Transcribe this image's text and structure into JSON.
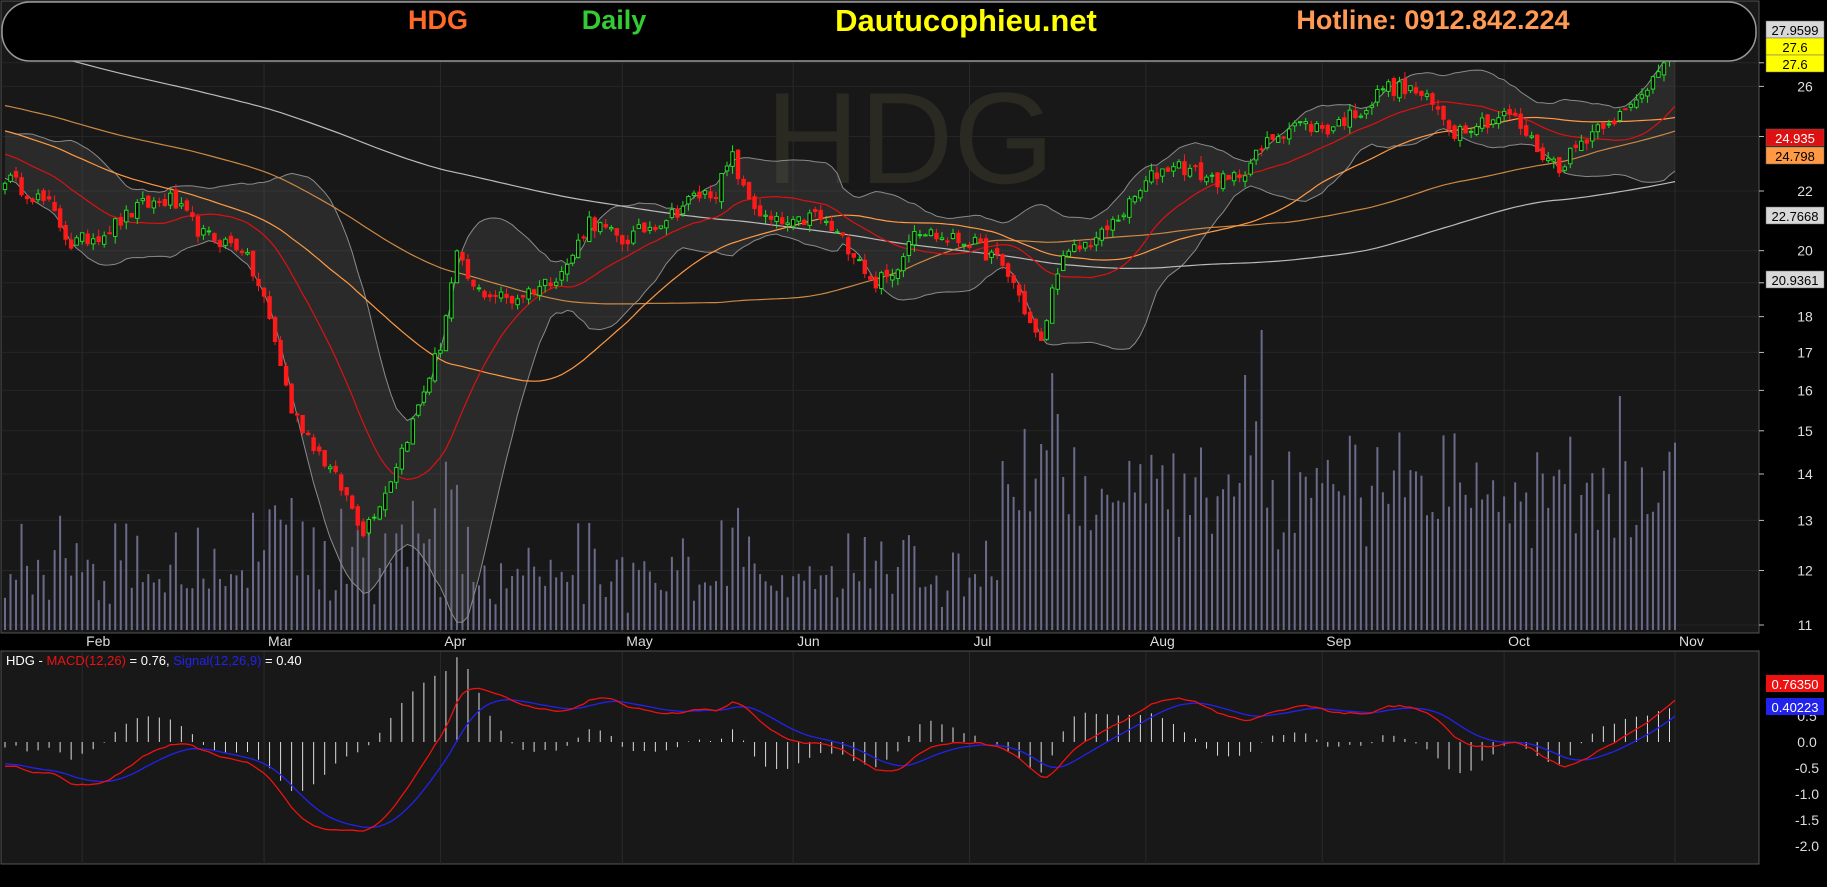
{
  "header": {
    "symbol": "HDG",
    "period": "Daily",
    "site": "Dautucophieu.net",
    "hotline": "Hotline: 0912.842.224",
    "symbol_color": "#ff6a2a",
    "period_color": "#33cc33",
    "site_color": "#ffff00",
    "hotline_color": "#ff9a55"
  },
  "watermark": "HDG",
  "chart_data": [
    {
      "type": "candlestick",
      "panel": "price",
      "x_labels": [
        "Feb",
        "Mar",
        "Apr",
        "May",
        "Jun",
        "Jul",
        "Aug",
        "Sep",
        "Oct",
        "Nov"
      ],
      "y_ticks": [
        11,
        12,
        13,
        14,
        15,
        16,
        17,
        18,
        19,
        20,
        22,
        24,
        26,
        27
      ],
      "ylim": [
        11,
        28
      ],
      "y_scale": "log",
      "grid": true,
      "price_tags": [
        {
          "label": "27.9599",
          "bg": "#d8d8d8",
          "fg": "#000000"
        },
        {
          "label": "27.6",
          "bg": "#ffff00",
          "fg": "#000000"
        },
        {
          "label": "27.6",
          "bg": "#ffff00",
          "fg": "#000000"
        },
        {
          "label": "24.935",
          "bg": "#dd1111",
          "fg": "#ffffff"
        },
        {
          "label": "24.798",
          "bg": "#ff9944",
          "fg": "#000000"
        },
        {
          "label": "22.7668",
          "bg": "#d8d8d8",
          "fg": "#000000"
        },
        {
          "label": "20.9361",
          "bg": "#d8d8d8",
          "fg": "#000000"
        }
      ],
      "close_anchors": [
        [
          0,
          22.5
        ],
        [
          8,
          21.5
        ],
        [
          12,
          20.2
        ],
        [
          18,
          20.6
        ],
        [
          25,
          21.5
        ],
        [
          30,
          21.7
        ],
        [
          36,
          20.5
        ],
        [
          43,
          20.1
        ],
        [
          47,
          18.5
        ],
        [
          52,
          15.5
        ],
        [
          57,
          14.5
        ],
        [
          62,
          13.5
        ],
        [
          65,
          12.8
        ],
        [
          69,
          13.6
        ],
        [
          74,
          15.2
        ],
        [
          79,
          17.2
        ],
        [
          82,
          19.8
        ],
        [
          85,
          18.8
        ],
        [
          92,
          18.5
        ],
        [
          98,
          19.0
        ],
        [
          102,
          19.5
        ],
        [
          106,
          21.0
        ],
        [
          112,
          20.3
        ],
        [
          117,
          20.8
        ],
        [
          121,
          21.2
        ],
        [
          125,
          21.8
        ],
        [
          129,
          22.0
        ],
        [
          132,
          23.2
        ],
        [
          134,
          22.0
        ],
        [
          138,
          21.0
        ],
        [
          143,
          20.8
        ],
        [
          147,
          21.2
        ],
        [
          151,
          20.5
        ],
        [
          155,
          19.8
        ],
        [
          157,
          19.0
        ],
        [
          161,
          19.2
        ],
        [
          165,
          20.8
        ],
        [
          170,
          20.4
        ],
        [
          175,
          20.3
        ],
        [
          180,
          19.7
        ],
        [
          183,
          19.0
        ],
        [
          186,
          17.8
        ],
        [
          188,
          17.2
        ],
        [
          191,
          19.5
        ],
        [
          194,
          20.0
        ],
        [
          199,
          20.5
        ],
        [
          204,
          21.5
        ],
        [
          208,
          22.5
        ],
        [
          212,
          23.0
        ],
        [
          218,
          22.5
        ],
        [
          222,
          22.3
        ],
        [
          226,
          23.0
        ],
        [
          230,
          24.0
        ],
        [
          234,
          24.5
        ],
        [
          240,
          24.3
        ],
        [
          244,
          24.8
        ],
        [
          248,
          25.3
        ],
        [
          250,
          26.0
        ],
        [
          256,
          25.8
        ],
        [
          260,
          25.0
        ],
        [
          263,
          24.2
        ],
        [
          266,
          24.5
        ],
        [
          270,
          24.7
        ],
        [
          273,
          24.9
        ],
        [
          276,
          24.1
        ],
        [
          279,
          23.3
        ],
        [
          282,
          22.9
        ],
        [
          286,
          23.8
        ],
        [
          290,
          24.6
        ],
        [
          294,
          24.9
        ],
        [
          297,
          25.6
        ],
        [
          301,
          27.3
        ],
        [
          303,
          27.6
        ]
      ],
      "overlays": [
        {
          "name": "MA20",
          "color": "#dd1111"
        },
        {
          "name": "MA50",
          "color": "#ff9944"
        },
        {
          "name": "MA100",
          "color": "#cc8844"
        },
        {
          "name": "MA200",
          "color": "#bbbbbb"
        },
        {
          "name": "Bollinger Bands (20,2)",
          "color": "#888888"
        }
      ],
      "volume": {
        "color": "#6a6a8a",
        "relative_peaks": [
          [
            188,
            0.62
          ],
          [
            225,
            0.85
          ],
          [
            228,
            1.0
          ],
          [
            293,
            0.78
          ]
        ]
      }
    },
    {
      "type": "line",
      "panel": "macd",
      "legend": {
        "symbol": "HDG - ",
        "macd_label": "MACD(12,26)",
        "macd_value": " = 0.76, ",
        "signal_label": "Signal(12,26,9)",
        "signal_value": " = 0.40"
      },
      "y_ticks": [
        "0.5",
        "0.0",
        "-0.5",
        "-1.0",
        "-1.5",
        "-2.0"
      ],
      "ylim": [
        -2.1,
        1.1
      ],
      "series": [
        {
          "name": "MACD(12,26)",
          "color": "#ee1111",
          "last": "0.76350"
        },
        {
          "name": "Signal(12,26,9)",
          "color": "#2222ee",
          "last": "0.40223"
        }
      ],
      "histogram_color": "#dddddd"
    }
  ]
}
